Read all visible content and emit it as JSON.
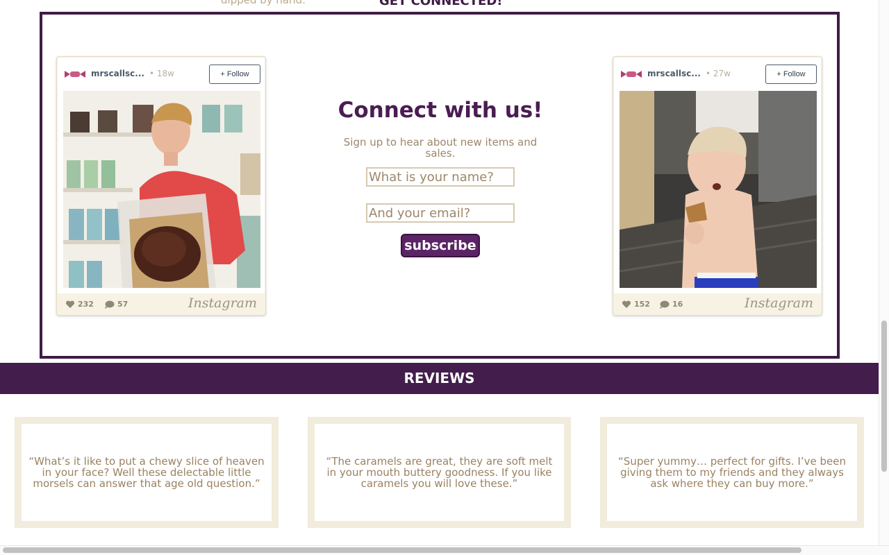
{
  "top_partial": {
    "left_text": "dipped by hand.",
    "right_text": "GET CONNECTED!"
  },
  "instagram_posts": [
    {
      "username": "mrscallsc...",
      "age": "• 18w",
      "follow_label": "+ Follow",
      "likes": "232",
      "comments": "57",
      "brand": "Instagram"
    },
    {
      "username": "mrscallsc...",
      "age": "• 27w",
      "follow_label": "+ Follow",
      "likes": "152",
      "comments": "16",
      "brand": "Instagram"
    }
  ],
  "connect": {
    "title": "Connect with us!",
    "subtitle": "Sign up to hear about new items and sales.",
    "name_placeholder": "What is your name?",
    "email_placeholder": "And your email?",
    "subscribe_label": "subscribe"
  },
  "reviews": {
    "heading": "REVIEWS",
    "items": [
      "“What’s it like to put a chewy slice of heaven in your face? Well these delectable little morsels can answer that age old question.”",
      "“The caramels are great, they are soft melt in your mouth buttery goodness. If you like caramels you will love these.”",
      "“Super yummy… perfect for gifts. I’ve been giving them to my friends and they always ask where they can buy more.”"
    ]
  },
  "colors": {
    "brand_purple": "#431d4c",
    "accent_tan": "#9c8769",
    "cream": "#f1ecdb"
  }
}
